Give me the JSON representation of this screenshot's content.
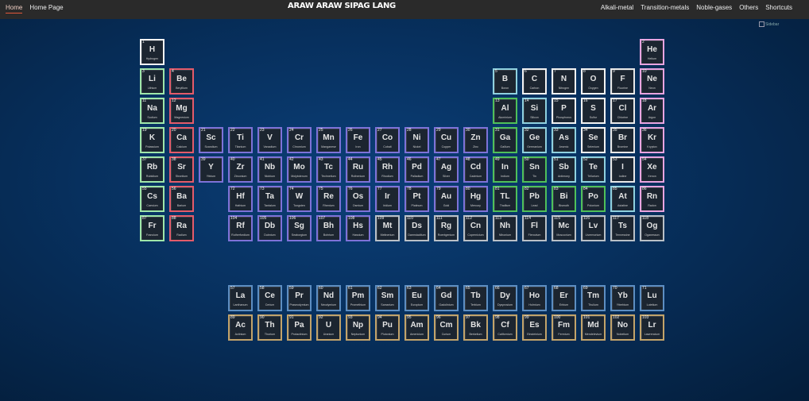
{
  "nav": {
    "left": [
      {
        "label": "Home",
        "active": true
      },
      {
        "label": "Home Page",
        "active": false
      }
    ],
    "title": "ARAW ARAW SIPAG LANG",
    "right": [
      {
        "label": "Alkali-metal"
      },
      {
        "label": "Transition-metals"
      },
      {
        "label": "Noble-gases"
      },
      {
        "label": "Others"
      },
      {
        "label": "Shortcuts"
      }
    ]
  },
  "broken_image_alt": "Sidebar",
  "elements": [
    {
      "n": "1",
      "s": "H",
      "name": "Hydrogen",
      "c": "nonmetal",
      "r": 0,
      "col": 0
    },
    {
      "n": "2",
      "s": "He",
      "name": "Helium",
      "c": "noble",
      "r": 0,
      "col": 17
    },
    {
      "n": "3",
      "s": "Li",
      "name": "Lithium",
      "c": "alkali",
      "r": 1,
      "col": 0
    },
    {
      "n": "4",
      "s": "Be",
      "name": "Beryllium",
      "c": "alkaline",
      "r": 1,
      "col": 1
    },
    {
      "n": "5",
      "s": "B",
      "name": "Boron",
      "c": "metalloid",
      "r": 1,
      "col": 12
    },
    {
      "n": "6",
      "s": "C",
      "name": "Carbon",
      "c": "nonmetal",
      "r": 1,
      "col": 13
    },
    {
      "n": "7",
      "s": "N",
      "name": "Nitrogen",
      "c": "nonmetal",
      "r": 1,
      "col": 14
    },
    {
      "n": "8",
      "s": "O",
      "name": "Oxygen",
      "c": "nonmetal",
      "r": 1,
      "col": 15
    },
    {
      "n": "9",
      "s": "F",
      "name": "Fluorine",
      "c": "halogen",
      "r": 1,
      "col": 16
    },
    {
      "n": "10",
      "s": "Ne",
      "name": "Neon",
      "c": "noble",
      "r": 1,
      "col": 17
    },
    {
      "n": "11",
      "s": "Na",
      "name": "Sodium",
      "c": "alkali",
      "r": 2,
      "col": 0
    },
    {
      "n": "12",
      "s": "Mg",
      "name": "Magnesium",
      "c": "alkaline",
      "r": 2,
      "col": 1
    },
    {
      "n": "13",
      "s": "Al",
      "name": "Aluminium",
      "c": "post",
      "r": 2,
      "col": 12
    },
    {
      "n": "14",
      "s": "Si",
      "name": "Silicon",
      "c": "metalloid",
      "r": 2,
      "col": 13
    },
    {
      "n": "15",
      "s": "P",
      "name": "Phosphorus",
      "c": "nonmetal",
      "r": 2,
      "col": 14
    },
    {
      "n": "16",
      "s": "S",
      "name": "Sulfur",
      "c": "nonmetal",
      "r": 2,
      "col": 15
    },
    {
      "n": "17",
      "s": "Cl",
      "name": "Chlorine",
      "c": "halogen",
      "r": 2,
      "col": 16
    },
    {
      "n": "18",
      "s": "Ar",
      "name": "Argon",
      "c": "noble",
      "r": 2,
      "col": 17
    },
    {
      "n": "19",
      "s": "K",
      "name": "Potassium",
      "c": "alkali",
      "r": 3,
      "col": 0
    },
    {
      "n": "20",
      "s": "Ca",
      "name": "Calcium",
      "c": "alkaline",
      "r": 3,
      "col": 1
    },
    {
      "n": "21",
      "s": "Sc",
      "name": "Scandium",
      "c": "transition",
      "r": 3,
      "col": 2
    },
    {
      "n": "22",
      "s": "Ti",
      "name": "Titanium",
      "c": "transition",
      "r": 3,
      "col": 3
    },
    {
      "n": "23",
      "s": "V",
      "name": "Vanadium",
      "c": "transition",
      "r": 3,
      "col": 4
    },
    {
      "n": "24",
      "s": "Cr",
      "name": "Chromium",
      "c": "transition",
      "r": 3,
      "col": 5
    },
    {
      "n": "25",
      "s": "Mn",
      "name": "Manganese",
      "c": "transition",
      "r": 3,
      "col": 6
    },
    {
      "n": "26",
      "s": "Fe",
      "name": "Iron",
      "c": "transition",
      "r": 3,
      "col": 7
    },
    {
      "n": "27",
      "s": "Co",
      "name": "Cobalt",
      "c": "transition",
      "r": 3,
      "col": 8
    },
    {
      "n": "28",
      "s": "Ni",
      "name": "Nickel",
      "c": "transition",
      "r": 3,
      "col": 9
    },
    {
      "n": "29",
      "s": "Cu",
      "name": "Copper",
      "c": "transition",
      "r": 3,
      "col": 10
    },
    {
      "n": "30",
      "s": "Zn",
      "name": "Zinc",
      "c": "transition",
      "r": 3,
      "col": 11
    },
    {
      "n": "31",
      "s": "Ga",
      "name": "Gallium",
      "c": "post",
      "r": 3,
      "col": 12
    },
    {
      "n": "32",
      "s": "Ge",
      "name": "Germanium",
      "c": "metalloid",
      "r": 3,
      "col": 13
    },
    {
      "n": "33",
      "s": "As",
      "name": "Arsenic",
      "c": "metalloid",
      "r": 3,
      "col": 14
    },
    {
      "n": "34",
      "s": "Se",
      "name": "Selenium",
      "c": "nonmetal",
      "r": 3,
      "col": 15
    },
    {
      "n": "35",
      "s": "Br",
      "name": "Bromine",
      "c": "halogen",
      "r": 3,
      "col": 16
    },
    {
      "n": "36",
      "s": "Kr",
      "name": "Krypton",
      "c": "noble",
      "r": 3,
      "col": 17
    },
    {
      "n": "37",
      "s": "Rb",
      "name": "Rubidium",
      "c": "alkali",
      "r": 4,
      "col": 0
    },
    {
      "n": "38",
      "s": "Sr",
      "name": "Strontium",
      "c": "alkaline",
      "r": 4,
      "col": 1
    },
    {
      "n": "39",
      "s": "Y",
      "name": "Yttrium",
      "c": "transition",
      "r": 4,
      "col": 2
    },
    {
      "n": "40",
      "s": "Zr",
      "name": "Zirconium",
      "c": "transition",
      "r": 4,
      "col": 3
    },
    {
      "n": "41",
      "s": "Nb",
      "name": "Niobium",
      "c": "transition",
      "r": 4,
      "col": 4
    },
    {
      "n": "42",
      "s": "Mo",
      "name": "Molybdenum",
      "c": "transition",
      "r": 4,
      "col": 5
    },
    {
      "n": "43",
      "s": "Tc",
      "name": "Technetium",
      "c": "transition",
      "r": 4,
      "col": 6
    },
    {
      "n": "44",
      "s": "Ru",
      "name": "Ruthenium",
      "c": "transition",
      "r": 4,
      "col": 7
    },
    {
      "n": "45",
      "s": "Rh",
      "name": "Rhodium",
      "c": "transition",
      "r": 4,
      "col": 8
    },
    {
      "n": "46",
      "s": "Pd",
      "name": "Palladium",
      "c": "transition",
      "r": 4,
      "col": 9
    },
    {
      "n": "47",
      "s": "Ag",
      "name": "Silver",
      "c": "transition",
      "r": 4,
      "col": 10
    },
    {
      "n": "48",
      "s": "Cd",
      "name": "Cadmium",
      "c": "transition",
      "r": 4,
      "col": 11
    },
    {
      "n": "49",
      "s": "In",
      "name": "Indium",
      "c": "post",
      "r": 4,
      "col": 12
    },
    {
      "n": "50",
      "s": "Sn",
      "name": "Tin",
      "c": "post",
      "r": 4,
      "col": 13
    },
    {
      "n": "51",
      "s": "Sb",
      "name": "Antimony",
      "c": "metalloid",
      "r": 4,
      "col": 14
    },
    {
      "n": "52",
      "s": "Te",
      "name": "Tellurium",
      "c": "metalloid",
      "r": 4,
      "col": 15
    },
    {
      "n": "53",
      "s": "I",
      "name": "Iodine",
      "c": "halogen",
      "r": 4,
      "col": 16
    },
    {
      "n": "54",
      "s": "Xe",
      "name": "Xenon",
      "c": "noble",
      "r": 4,
      "col": 17
    },
    {
      "n": "55",
      "s": "Cs",
      "name": "Caesium",
      "c": "alkali",
      "r": 5,
      "col": 0
    },
    {
      "n": "56",
      "s": "Ba",
      "name": "Barium",
      "c": "alkaline",
      "r": 5,
      "col": 1
    },
    {
      "n": "72",
      "s": "Hf",
      "name": "Hafnium",
      "c": "transition",
      "r": 5,
      "col": 3
    },
    {
      "n": "73",
      "s": "Ta",
      "name": "Tantalum",
      "c": "transition",
      "r": 5,
      "col": 4
    },
    {
      "n": "74",
      "s": "W",
      "name": "Tungsten",
      "c": "transition",
      "r": 5,
      "col": 5
    },
    {
      "n": "75",
      "s": "Re",
      "name": "Rhenium",
      "c": "transition",
      "r": 5,
      "col": 6
    },
    {
      "n": "76",
      "s": "Os",
      "name": "Osmium",
      "c": "transition",
      "r": 5,
      "col": 7
    },
    {
      "n": "77",
      "s": "Ir",
      "name": "Iridium",
      "c": "transition",
      "r": 5,
      "col": 8
    },
    {
      "n": "78",
      "s": "Pt",
      "name": "Platinum",
      "c": "transition",
      "r": 5,
      "col": 9
    },
    {
      "n": "79",
      "s": "Au",
      "name": "Gold",
      "c": "transition",
      "r": 5,
      "col": 10
    },
    {
      "n": "80",
      "s": "Hg",
      "name": "Mercury",
      "c": "transition",
      "r": 5,
      "col": 11
    },
    {
      "n": "81",
      "s": "TL",
      "name": "Thallium",
      "c": "post",
      "r": 5,
      "col": 12
    },
    {
      "n": "82",
      "s": "Pb",
      "name": "Lead",
      "c": "post",
      "r": 5,
      "col": 13
    },
    {
      "n": "83",
      "s": "Bi",
      "name": "Bismuth",
      "c": "post",
      "r": 5,
      "col": 14
    },
    {
      "n": "84",
      "s": "Po",
      "name": "Polonium",
      "c": "post",
      "r": 5,
      "col": 15
    },
    {
      "n": "85",
      "s": "At",
      "name": "Astatine",
      "c": "metalloid",
      "r": 5,
      "col": 16
    },
    {
      "n": "86",
      "s": "Rn",
      "name": "Radon",
      "c": "noble",
      "r": 5,
      "col": 17
    },
    {
      "n": "87",
      "s": "Fr",
      "name": "Francium",
      "c": "alkali",
      "r": 6,
      "col": 0
    },
    {
      "n": "88",
      "s": "Ra",
      "name": "Radium",
      "c": "alkaline",
      "r": 6,
      "col": 1
    },
    {
      "n": "104",
      "s": "Rf",
      "name": "Rutherfordium",
      "c": "transition",
      "r": 6,
      "col": 3
    },
    {
      "n": "105",
      "s": "Db",
      "name": "Dubnium",
      "c": "transition",
      "r": 6,
      "col": 4
    },
    {
      "n": "106",
      "s": "Sg",
      "name": "Seaborgium",
      "c": "transition",
      "r": 6,
      "col": 5
    },
    {
      "n": "107",
      "s": "Bh",
      "name": "Bohrium",
      "c": "transition",
      "r": 6,
      "col": 6
    },
    {
      "n": "108",
      "s": "Hs",
      "name": "Hassium",
      "c": "transition",
      "r": 6,
      "col": 7
    },
    {
      "n": "109",
      "s": "Mt",
      "name": "Meitnerium",
      "c": "unk",
      "r": 6,
      "col": 8
    },
    {
      "n": "110",
      "s": "Ds",
      "name": "Darmstadtium",
      "c": "unk",
      "r": 6,
      "col": 9
    },
    {
      "n": "111",
      "s": "Rg",
      "name": "Roentgenium",
      "c": "unk",
      "r": 6,
      "col": 10
    },
    {
      "n": "112",
      "s": "Cn",
      "name": "Copernicium",
      "c": "unk",
      "r": 6,
      "col": 11
    },
    {
      "n": "113",
      "s": "Nh",
      "name": "Nihonium",
      "c": "unk",
      "r": 6,
      "col": 12
    },
    {
      "n": "114",
      "s": "Fl",
      "name": "Flerovium",
      "c": "unk",
      "r": 6,
      "col": 13
    },
    {
      "n": "115",
      "s": "Mc",
      "name": "Moscovium",
      "c": "unk",
      "r": 6,
      "col": 14
    },
    {
      "n": "116",
      "s": "Lv",
      "name": "Livermorium",
      "c": "unk",
      "r": 6,
      "col": 15
    },
    {
      "n": "117",
      "s": "Ts",
      "name": "Tennessine",
      "c": "unk",
      "r": 6,
      "col": 16
    },
    {
      "n": "118",
      "s": "Og",
      "name": "Oganesson",
      "c": "unk",
      "r": 6,
      "col": 17
    },
    {
      "n": "57",
      "s": "La",
      "name": "Lanthanum",
      "c": "lanth",
      "r": 8,
      "col": 3
    },
    {
      "n": "58",
      "s": "Ce",
      "name": "Cerium",
      "c": "lanth",
      "r": 8,
      "col": 4
    },
    {
      "n": "59",
      "s": "Pr",
      "name": "Praseodymium",
      "c": "lanth",
      "r": 8,
      "col": 5
    },
    {
      "n": "60",
      "s": "Nd",
      "name": "Neodymium",
      "c": "lanth",
      "r": 8,
      "col": 6
    },
    {
      "n": "61",
      "s": "Pm",
      "name": "Promethium",
      "c": "lanth",
      "r": 8,
      "col": 7
    },
    {
      "n": "62",
      "s": "Sm",
      "name": "Samarium",
      "c": "lanth",
      "r": 8,
      "col": 8
    },
    {
      "n": "63",
      "s": "Eu",
      "name": "Europium",
      "c": "lanth",
      "r": 8,
      "col": 9
    },
    {
      "n": "64",
      "s": "Gd",
      "name": "Gadolinium",
      "c": "lanth",
      "r": 8,
      "col": 10
    },
    {
      "n": "65",
      "s": "Tb",
      "name": "Terbium",
      "c": "lanth",
      "r": 8,
      "col": 11
    },
    {
      "n": "66",
      "s": "Dy",
      "name": "Dysprosium",
      "c": "lanth",
      "r": 8,
      "col": 12
    },
    {
      "n": "67",
      "s": "Ho",
      "name": "Holmium",
      "c": "lanth",
      "r": 8,
      "col": 13
    },
    {
      "n": "68",
      "s": "Er",
      "name": "Erbium",
      "c": "lanth",
      "r": 8,
      "col": 14
    },
    {
      "n": "69",
      "s": "Tm",
      "name": "Thulium",
      "c": "lanth",
      "r": 8,
      "col": 15
    },
    {
      "n": "70",
      "s": "Yb",
      "name": "Ytterbium",
      "c": "lanth",
      "r": 8,
      "col": 16
    },
    {
      "n": "71",
      "s": "Lu",
      "name": "Lutetium",
      "c": "lanth",
      "r": 8,
      "col": 17
    },
    {
      "n": "89",
      "s": "Ac",
      "name": "Actinium",
      "c": "act",
      "r": 9,
      "col": 3
    },
    {
      "n": "90",
      "s": "Th",
      "name": "Thorium",
      "c": "act",
      "r": 9,
      "col": 4
    },
    {
      "n": "91",
      "s": "Pa",
      "name": "Protactinium",
      "c": "act",
      "r": 9,
      "col": 5
    },
    {
      "n": "92",
      "s": "U",
      "name": "Uranium",
      "c": "act",
      "r": 9,
      "col": 6
    },
    {
      "n": "93",
      "s": "Np",
      "name": "Neptunium",
      "c": "act",
      "r": 9,
      "col": 7
    },
    {
      "n": "94",
      "s": "Pu",
      "name": "Plutonium",
      "c": "act",
      "r": 9,
      "col": 8
    },
    {
      "n": "95",
      "s": "Am",
      "name": "Americium",
      "c": "act",
      "r": 9,
      "col": 9
    },
    {
      "n": "96",
      "s": "Cm",
      "name": "Curium",
      "c": "act",
      "r": 9,
      "col": 10
    },
    {
      "n": "97",
      "s": "Bk",
      "name": "Berkelium",
      "c": "act",
      "r": 9,
      "col": 11
    },
    {
      "n": "98",
      "s": "Cf",
      "name": "Californium",
      "c": "act",
      "r": 9,
      "col": 12
    },
    {
      "n": "99",
      "s": "Es",
      "name": "Einsteinium",
      "c": "act",
      "r": 9,
      "col": 13
    },
    {
      "n": "100",
      "s": "Fm",
      "name": "Fermium",
      "c": "act",
      "r": 9,
      "col": 14
    },
    {
      "n": "101",
      "s": "Md",
      "name": "Mendelevium",
      "c": "act",
      "r": 9,
      "col": 15
    },
    {
      "n": "102",
      "s": "No",
      "name": "Nobelium",
      "c": "act",
      "r": 9,
      "col": 16
    },
    {
      "n": "103",
      "s": "Lr",
      "name": "Lawrencium",
      "c": "act",
      "r": 9,
      "col": 17
    }
  ]
}
